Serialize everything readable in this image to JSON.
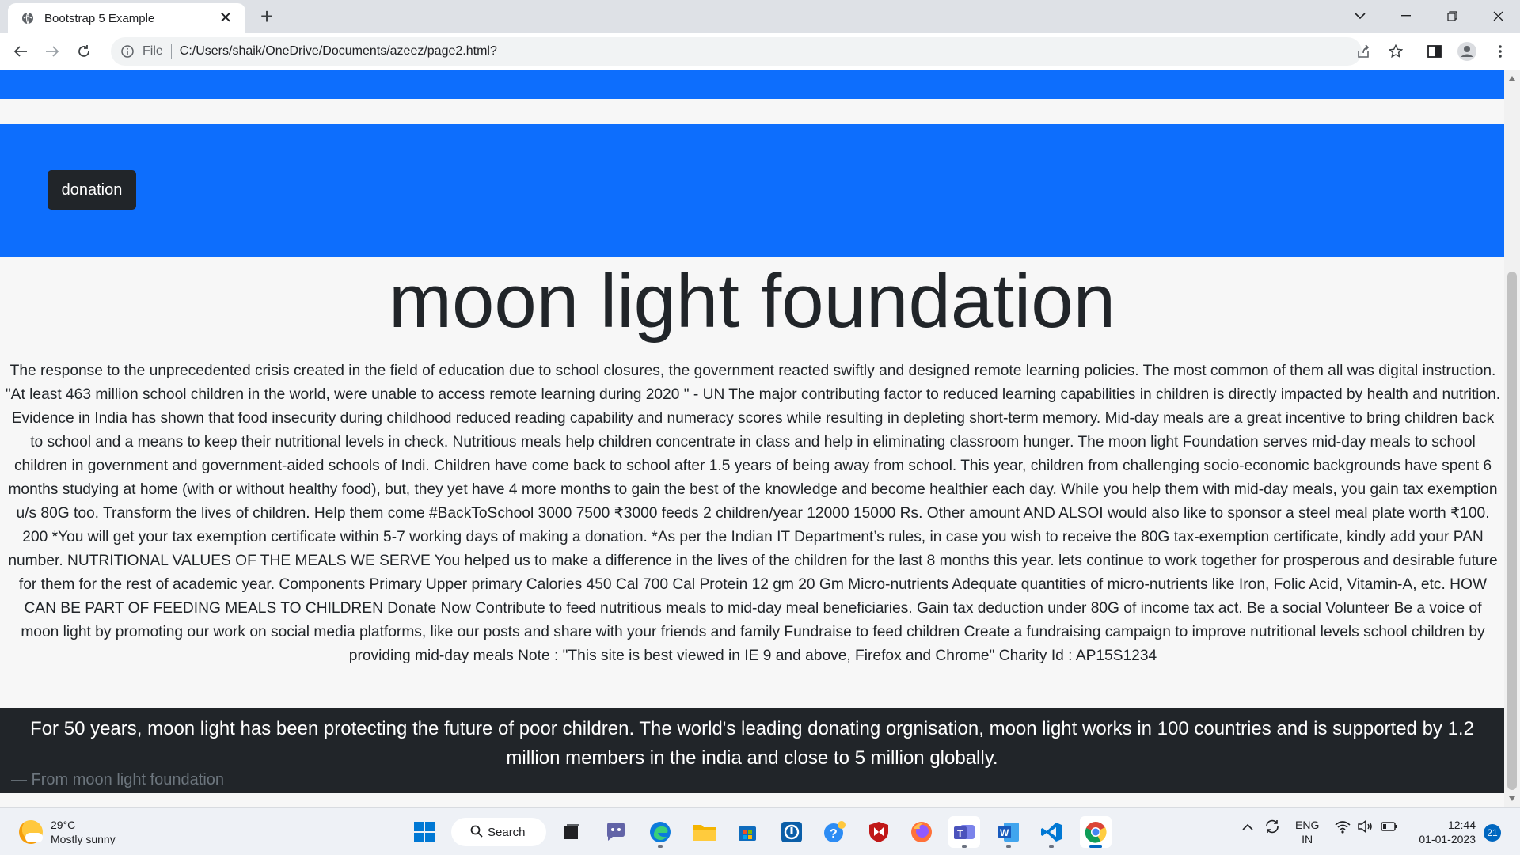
{
  "browser": {
    "tab_title": "Bootstrap 5 Example",
    "tab_close": "✕",
    "new_tab": "+",
    "scheme_label": "File",
    "url": "C:/Users/shaik/OneDrive/Documents/azeez/page2.html?"
  },
  "page": {
    "donation_button": "donation",
    "title": "moon light foundation",
    "body": "The response to the unprecedented crisis created in the field of education due to school closures, the government reacted swiftly and designed remote learning policies. The most common of them all was digital instruction. \"At least 463 million school children in the world, were unable to access remote learning during 2020 \" - UN The major contributing factor to reduced learning capabilities in children is directly impacted by health and nutrition. Evidence in India has shown that food insecurity during childhood reduced reading capability and numeracy scores while resulting in depleting short-term memory. Mid-day meals are a great incentive to bring children back to school and a means to keep their nutritional levels in check. Nutritious meals help children concentrate in class and help in eliminating classroom hunger. The moon light Foundation serves mid-day meals to school children in government and government-aided schools of Indi. Children have come back to school after 1.5 years of being away from school. This year, children from challenging socio-economic backgrounds have spent 6 months studying at home (with or without healthy food), but, they yet have 4 more months to gain the best of the knowledge and become healthier each day. While you help them with mid-day meals, you gain tax exemption u/s 80G too. Transform the lives of children. Help them come #BackToSchool 3000 7500 ₹3000 feeds 2 children/year 12000 15000 Rs. Other amount AND ALSOI would also like to sponsor a steel meal plate worth ₹100. 200 *You will get your tax exemption certificate within 5-7 working days of making a donation. *As per the Indian IT Department’s rules, in case you wish to receive the 80G tax-exemption certificate, kindly add your PAN number. NUTRITIONAL VALUES OF THE MEALS WE SERVE You helped us to make a difference in the lives of the children for the last 8 months this year. lets continue to work together for prosperous and desirable future for them for the rest of academic year. Components Primary Upper primary Calories 450 Cal 700 Cal Protein 12 gm 20 Gm Micro-nutrients Adequate quantities of micro-nutrients like Iron, Folic Acid, Vitamin-A, etc. HOW CAN BE PART OF FEEDING MEALS TO CHILDREN Donate Now Contribute to feed nutritious meals to mid-day meal beneficiaries. Gain tax deduction under 80G of income tax act. Be a social Volunteer Be a voice of moon light by promoting our work on social media platforms, like our posts and share with your friends and family Fundraise to feed children Create a fundraising campaign to improve nutritional levels school children by providing mid-day meals Note : \"This site is best viewed in IE 9 and above, Firefox and Chrome\" Charity Id : AP15S1234",
    "quote": "For 50 years, moon light has been protecting the future of poor children. The world's leading donating orgnisation, moon light works in 100 countries and is supported by 1.2 million members in the india and close to 5 million globally.",
    "quote_footer": "— From moon light foundation"
  },
  "taskbar": {
    "temperature": "29°C",
    "weather": "Mostly sunny",
    "search_label": "Search",
    "lang_line1": "ENG",
    "lang_line2": "IN",
    "time": "12:44",
    "date": "01-01-2023",
    "notification_count": "21"
  },
  "colors": {
    "primary_blue": "#0d6efd",
    "dark": "#212529",
    "muted": "#6c757d"
  }
}
